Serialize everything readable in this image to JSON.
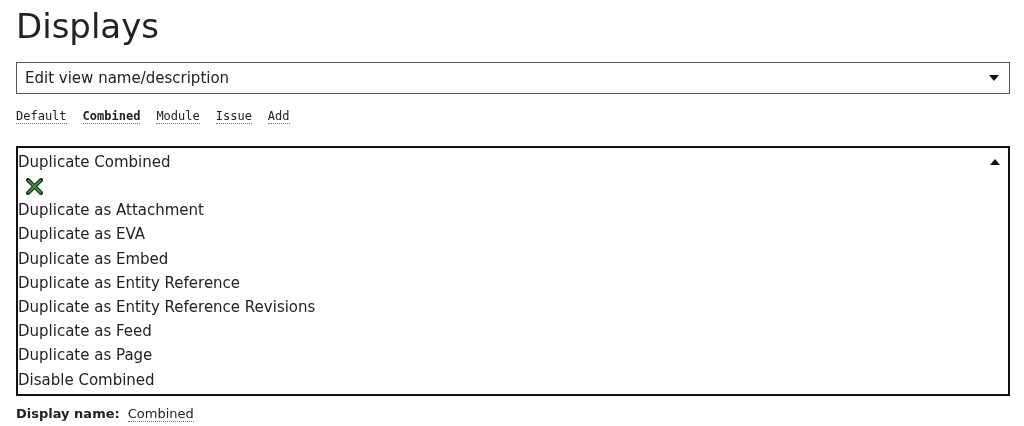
{
  "heading": "Displays",
  "view_select": {
    "value": "Edit view name/description",
    "expanded": false
  },
  "tabs": [
    {
      "label": "Default",
      "selected": false
    },
    {
      "label": "Combined",
      "selected": true
    },
    {
      "label": "Module",
      "selected": false
    },
    {
      "label": "Issue",
      "selected": false
    },
    {
      "label": "Add",
      "selected": false
    }
  ],
  "actions_dropdown": {
    "title": "Duplicate Combined",
    "expanded": true,
    "items": [
      {
        "kind": "icon"
      },
      {
        "kind": "text",
        "label": "Duplicate as Attachment"
      },
      {
        "kind": "text",
        "label": "Duplicate as EVA"
      },
      {
        "kind": "text",
        "label": "Duplicate as Embed"
      },
      {
        "kind": "text",
        "label": "Duplicate as Entity Reference"
      },
      {
        "kind": "text",
        "label": "Duplicate as Entity Reference Revisions"
      },
      {
        "kind": "text",
        "label": "Duplicate as Feed"
      },
      {
        "kind": "text",
        "label": "Duplicate as Page"
      },
      {
        "kind": "text",
        "label": "Disable Combined"
      }
    ]
  },
  "display_name": {
    "label": "Display name:",
    "value": "Combined"
  }
}
